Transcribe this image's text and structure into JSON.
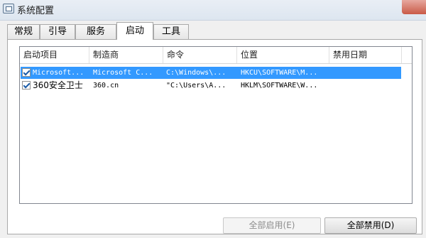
{
  "window": {
    "title": "系统配置"
  },
  "tabs": [
    {
      "label": "常规"
    },
    {
      "label": "引导"
    },
    {
      "label": "服务"
    },
    {
      "label": "启动"
    },
    {
      "label": "工具"
    }
  ],
  "active_tab": "启动",
  "columns": [
    "启动项目",
    "制造商",
    "命令",
    "位置",
    "禁用日期"
  ],
  "rows": [
    {
      "checked": true,
      "selected": true,
      "item": "Microsoft...",
      "maker": "Microsoft C...",
      "command": "C:\\Windows\\...",
      "location": "HKCU\\SOFTWARE\\M...",
      "disabled_date": ""
    },
    {
      "checked": true,
      "selected": false,
      "item": "360安全卫士",
      "maker": "360.cn",
      "command": "\"C:\\Users\\A...",
      "location": "HKLM\\SOFTWARE\\W...",
      "disabled_date": ""
    }
  ],
  "buttons": {
    "enable_all": "全部启用(E)",
    "disable_all": "全部禁用(D)"
  },
  "colors": {
    "selection": "#3399ff",
    "check": "#1b5ca8"
  }
}
